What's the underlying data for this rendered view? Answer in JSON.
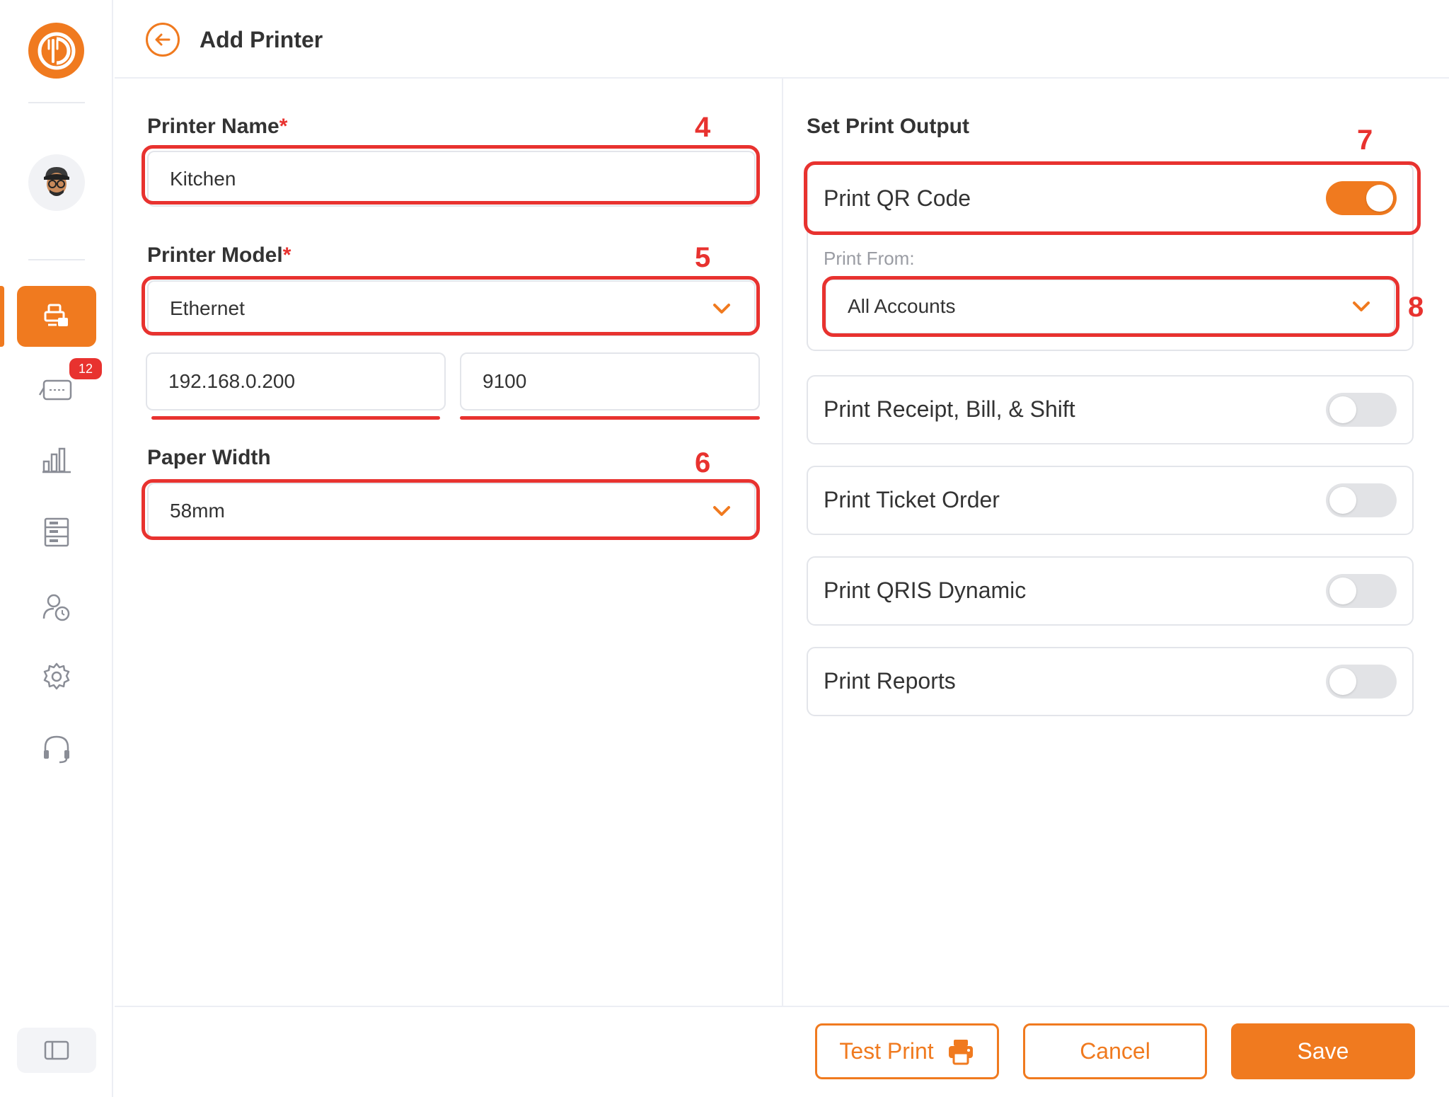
{
  "header": {
    "title": "Add Printer"
  },
  "sidebar": {
    "notification_badge": "12"
  },
  "form": {
    "printer_name": {
      "label": "Printer Name",
      "required_mark": "*",
      "value": "Kitchen"
    },
    "printer_model": {
      "label": "Printer Model",
      "required_mark": "*",
      "value": "Ethernet"
    },
    "ip_address": {
      "value": "192.168.0.200"
    },
    "port": {
      "value": "9100"
    },
    "paper_width": {
      "label": "Paper Width",
      "value": "58mm"
    }
  },
  "output": {
    "title": "Set Print Output",
    "print_qr": {
      "label": "Print QR Code",
      "enabled": true
    },
    "print_from": {
      "label": "Print From:",
      "value": "All Accounts"
    },
    "options": [
      {
        "label": "Print Receipt, Bill, & Shift",
        "enabled": false
      },
      {
        "label": "Print Ticket Order",
        "enabled": false
      },
      {
        "label": "Print QRIS Dynamic",
        "enabled": false
      },
      {
        "label": "Print Reports",
        "enabled": false
      }
    ]
  },
  "annotations": {
    "n4": "4",
    "n5": "5",
    "n6": "6",
    "n7": "7",
    "n8": "8"
  },
  "footer": {
    "test_print": "Test Print",
    "cancel": "Cancel",
    "save": "Save"
  },
  "colors": {
    "accent": "#f07a1f",
    "annotation": "#e8322f"
  }
}
